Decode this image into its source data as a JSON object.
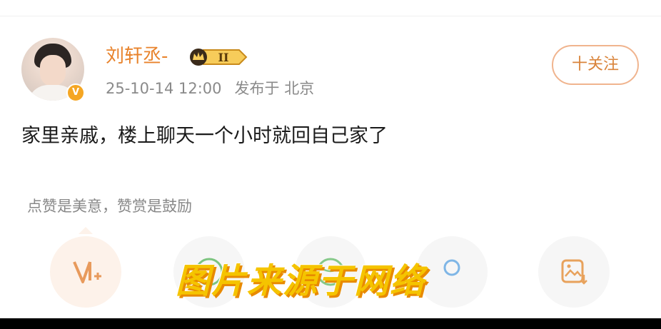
{
  "post": {
    "username": "刘轩丞-",
    "level_badge": "II",
    "timestamp": "25-10-14 12:00",
    "published_prefix": "发布于",
    "location": "北京",
    "follow_label": "十关注",
    "content": "家里亲戚，楼上聊天一个小时就回自己家了",
    "support_hint": "点赞是美意，赞赏是鼓励"
  },
  "watermark": "图片来源于网络",
  "colors": {
    "accent": "#e8832c",
    "follow_border": "#f0b48e",
    "watermark": "#f5c400",
    "verified": "#f5a623"
  },
  "icons": {
    "verified_badge": "v-verified-icon",
    "actions": [
      "v-plus-icon",
      "smile-emoji-icon",
      "ball-icon",
      "gift-icon",
      "image-download-icon"
    ]
  }
}
